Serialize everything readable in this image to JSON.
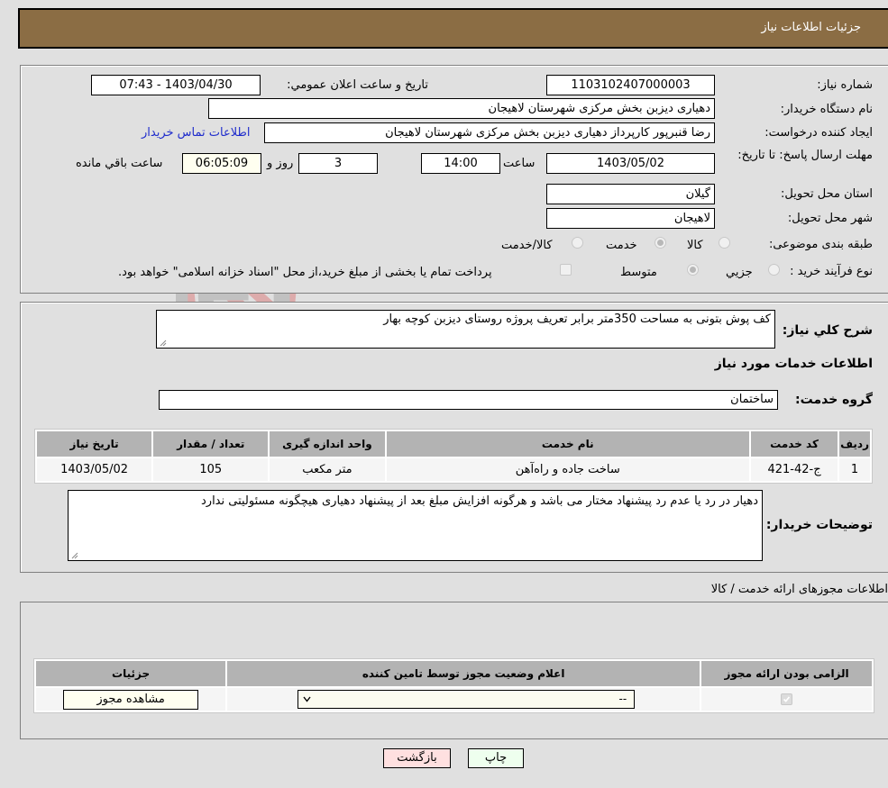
{
  "header": {
    "title": "جزئیات اطلاعات نیاز"
  },
  "fields": {
    "need_number_label": "شماره نیاز:",
    "need_number": "1103102407000003",
    "announce_label": "تاریخ و ساعت اعلان عمومي:",
    "announce_value": "1403/04/30 - 07:43",
    "buyer_org_label": "نام دستگاه خریدار:",
    "buyer_org": "دهیاری دیزبن بخش مرکزی شهرستان لاهیجان",
    "creator_label": "ایجاد کننده درخواست:",
    "creator": "رضا قنبرپور کارپرداز دهیاری دیزبن بخش مرکزی شهرستان لاهیجان",
    "contact_link": "اطلاعات تماس خریدار",
    "deadline_label": "مهلت ارسال پاسخ: تا تاریخ:",
    "deadline_date": "1403/05/02",
    "time_label": "ساعت",
    "deadline_time": "14:00",
    "days_value": "3",
    "days_label": "روز و",
    "remaining_time": "06:05:09",
    "remaining_label": "ساعت باقي مانده",
    "province_label": "استان محل تحویل:",
    "province": "گیلان",
    "city_label": "شهر محل تحویل:",
    "city": "لاهیجان",
    "category_label": "طبقه بندی موضوعی:",
    "category_options": [
      {
        "label": "کالا",
        "checked": false
      },
      {
        "label": "خدمت",
        "checked": true
      },
      {
        "label": "کالا/خدمت",
        "checked": false
      }
    ],
    "process_label": "نوع فرآیند خرید :",
    "process_options": [
      {
        "label": "جزيي",
        "checked": false
      },
      {
        "label": "متوسط",
        "checked": true
      }
    ],
    "treasury_note": "پرداخت تمام یا بخشی از مبلغ خرید،از محل \"اسناد خزانه اسلامی\" خواهد بود."
  },
  "description": {
    "label": "شرح کلي نیاز:",
    "value": "کف پوش بتونی به مساحت 350متر برابر تعریف پروژه روستای دیزبن کوچه بهار"
  },
  "services": {
    "section_title": "اطلاعات خدمات مورد نیاز",
    "group_label": "گروه خدمت:",
    "group_value": "ساختمان",
    "columns": [
      "ردیف",
      "کد خدمت",
      "نام خدمت",
      "واحد اندازه گیری",
      "تعداد / مقدار",
      "تاریخ نیاز"
    ],
    "rows": [
      {
        "index": "1",
        "code": "ج-42-421",
        "name": "ساخت جاده و راه‌آهن",
        "unit": "متر مکعب",
        "qty": "105",
        "date": "1403/05/02"
      }
    ]
  },
  "buyer_notes": {
    "label": "توضیحات خریدار:",
    "value": "دهیار در رد یا عدم رد پیشنهاد مختار می باشد و هرگونه افزایش مبلغ بعد از پیشنهاد دهیاری هیچگونه مسئولیتی ندارد"
  },
  "permits": {
    "section_title": "اطلاعات مجوزهای ارائه خدمت / کالا",
    "columns": [
      "الزامی بودن ارائه مجوز",
      "اعلام وضعیت مجوز توسط تامین کننده",
      "جزئیات"
    ],
    "row": {
      "required": true,
      "status_select": "--",
      "view_button": "مشاهده مجوز"
    }
  },
  "footer": {
    "print_button": "چاپ",
    "back_button": "بازگشت"
  },
  "watermark": {
    "text": "AriaTender.neT"
  },
  "colors": {
    "header_bg": "#8b6d44",
    "link": "#1f2ccc",
    "back_btn": "#ffe0e0",
    "print_btn": "#eeffee"
  }
}
